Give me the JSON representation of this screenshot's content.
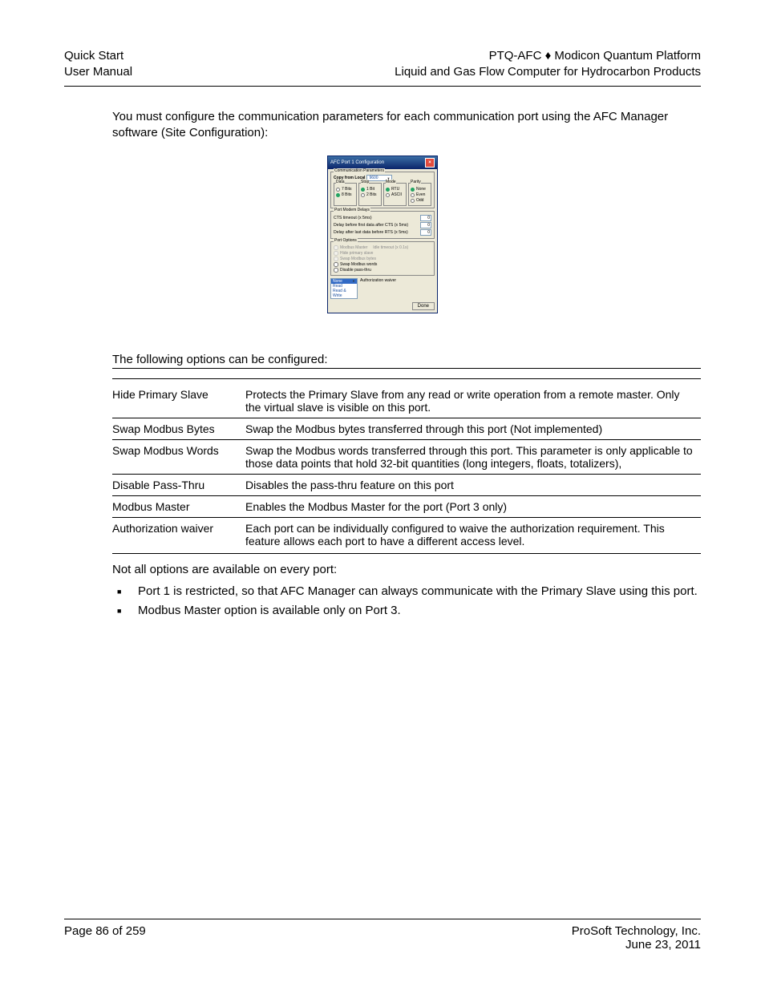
{
  "header": {
    "left1": "Quick Start",
    "left2": "User Manual",
    "right1": "PTQ-AFC ♦ Modicon Quantum Platform",
    "right2": "Liquid and Gas Flow Computer for Hydrocarbon Products"
  },
  "intro": "You must configure the communication parameters for each communication port using the AFC Manager software (Site Configuration):",
  "dialog": {
    "title": "AFC Port 1 Configuration",
    "comm_params_title": "Communication Parameters",
    "copy_from_label": "Copy from Local",
    "baud_value": "9600",
    "groups": {
      "data": {
        "title": "Data",
        "opt1": "7 Bits",
        "opt2": "8 Bits",
        "selected": "8 Bits"
      },
      "stop": {
        "title": "Stop",
        "opt1": "1 Bit",
        "opt2": "2 Bits",
        "selected": "1 Bit"
      },
      "mode": {
        "title": "Mode",
        "opt1": "RTU",
        "opt2": "ASCII",
        "selected": "RTU"
      },
      "parity": {
        "title": "Parity",
        "opt1": "None",
        "opt2": "Even",
        "opt3": "Odd",
        "selected": "None"
      }
    },
    "modem_delays": {
      "title": "Port Modem Delays",
      "row1": "CTS timeout (x 5ms)",
      "row2": "Delay before first data after CTS (x 5ms)",
      "row3": "Delay after last data before RTS (x 5ms)",
      "v1": "0",
      "v2": "0",
      "v3": "0"
    },
    "port_options": {
      "title": "Port Options",
      "modbus_master": "Modbus Master",
      "idle_timeout": "Idle timeout (x 0.1s)",
      "hide_primary": "Hide primary slave",
      "swap_bytes": "Swap Modbus bytes",
      "swap_words": "Swap Modbus words",
      "disable_pass": "Disable pass-thru"
    },
    "auth": {
      "label": "Authorization waiver",
      "current": "None",
      "opt2": "Read",
      "opt3": "Read & Write"
    },
    "done": "Done"
  },
  "following_opts": "The following options can be configured:",
  "table": {
    "rows": [
      {
        "k": "Hide Primary Slave",
        "v": "Protects the Primary Slave from any read or write operation from a remote master. Only the virtual slave is visible on this port."
      },
      {
        "k": "Swap Modbus Bytes",
        "v": "Swap the Modbus bytes transferred through this port (Not implemented)"
      },
      {
        "k": "Swap Modbus Words",
        "v": "Swap the Modbus words transferred through this port. This parameter is only applicable to those data points that hold 32-bit quantities (long integers, floats, totalizers),"
      },
      {
        "k": "Disable Pass-Thru",
        "v": "Disables the pass-thru feature on this port"
      },
      {
        "k": "Modbus Master",
        "v": "Enables the Modbus Master for the port (Port 3 only)"
      },
      {
        "k": "Authorization waiver",
        "v": "Each port can be individually configured to waive the authorization requirement. This feature allows each port to have a different access level."
      }
    ]
  },
  "not_all": "Not all options are available on every port:",
  "bullets": {
    "b1": "Port 1 is restricted, so that AFC Manager can always communicate with the Primary Slave using this port.",
    "b2": "Modbus Master option is available only on Port 3."
  },
  "footer": {
    "left": "Page 86 of 259",
    "right1": "ProSoft Technology, Inc.",
    "right2": "June 23, 2011"
  }
}
